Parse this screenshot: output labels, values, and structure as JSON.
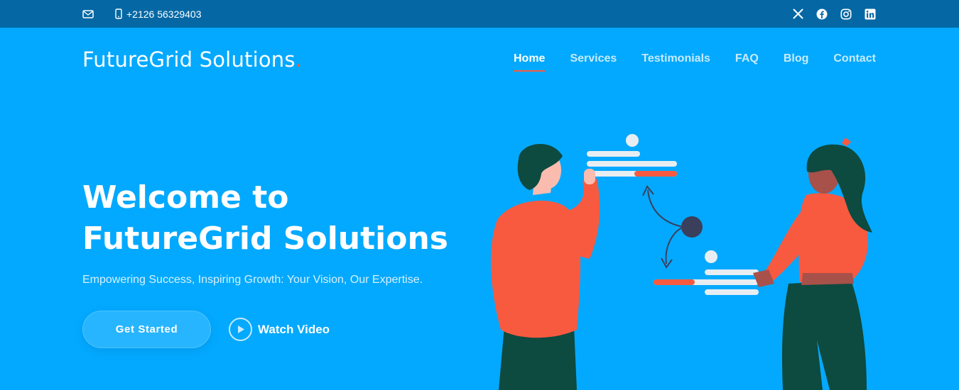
{
  "topbar": {
    "email_icon": "envelope-icon",
    "phone_icon": "mobile-phone-icon",
    "phone": "+2126 56329403",
    "social": [
      "x-twitter-icon",
      "facebook-icon",
      "instagram-icon",
      "linkedin-icon"
    ]
  },
  "header": {
    "logo_text": "FutureGrid Solutions",
    "logo_dot": ".",
    "nav": [
      {
        "label": "Home",
        "active": true
      },
      {
        "label": "Services",
        "active": false
      },
      {
        "label": "Testimonials",
        "active": false
      },
      {
        "label": "FAQ",
        "active": false
      },
      {
        "label": "Blog",
        "active": false
      },
      {
        "label": "Contact",
        "active": false
      }
    ]
  },
  "hero": {
    "title_line1": "Welcome to",
    "title_line2": "FutureGrid Solutions",
    "subtitle": "Empowering Success, Inspiring Growth: Your Vision, Our Expertise.",
    "cta_primary": "Get Started",
    "cta_secondary": "Watch Video",
    "play_icon": "play-circle-icon"
  },
  "colors": {
    "background": "#03a9fe",
    "topbar": "#0568a5",
    "accent": "#f85a40",
    "figure_shirt": "#f85a40",
    "figure_dark": "#0d4a3f"
  }
}
